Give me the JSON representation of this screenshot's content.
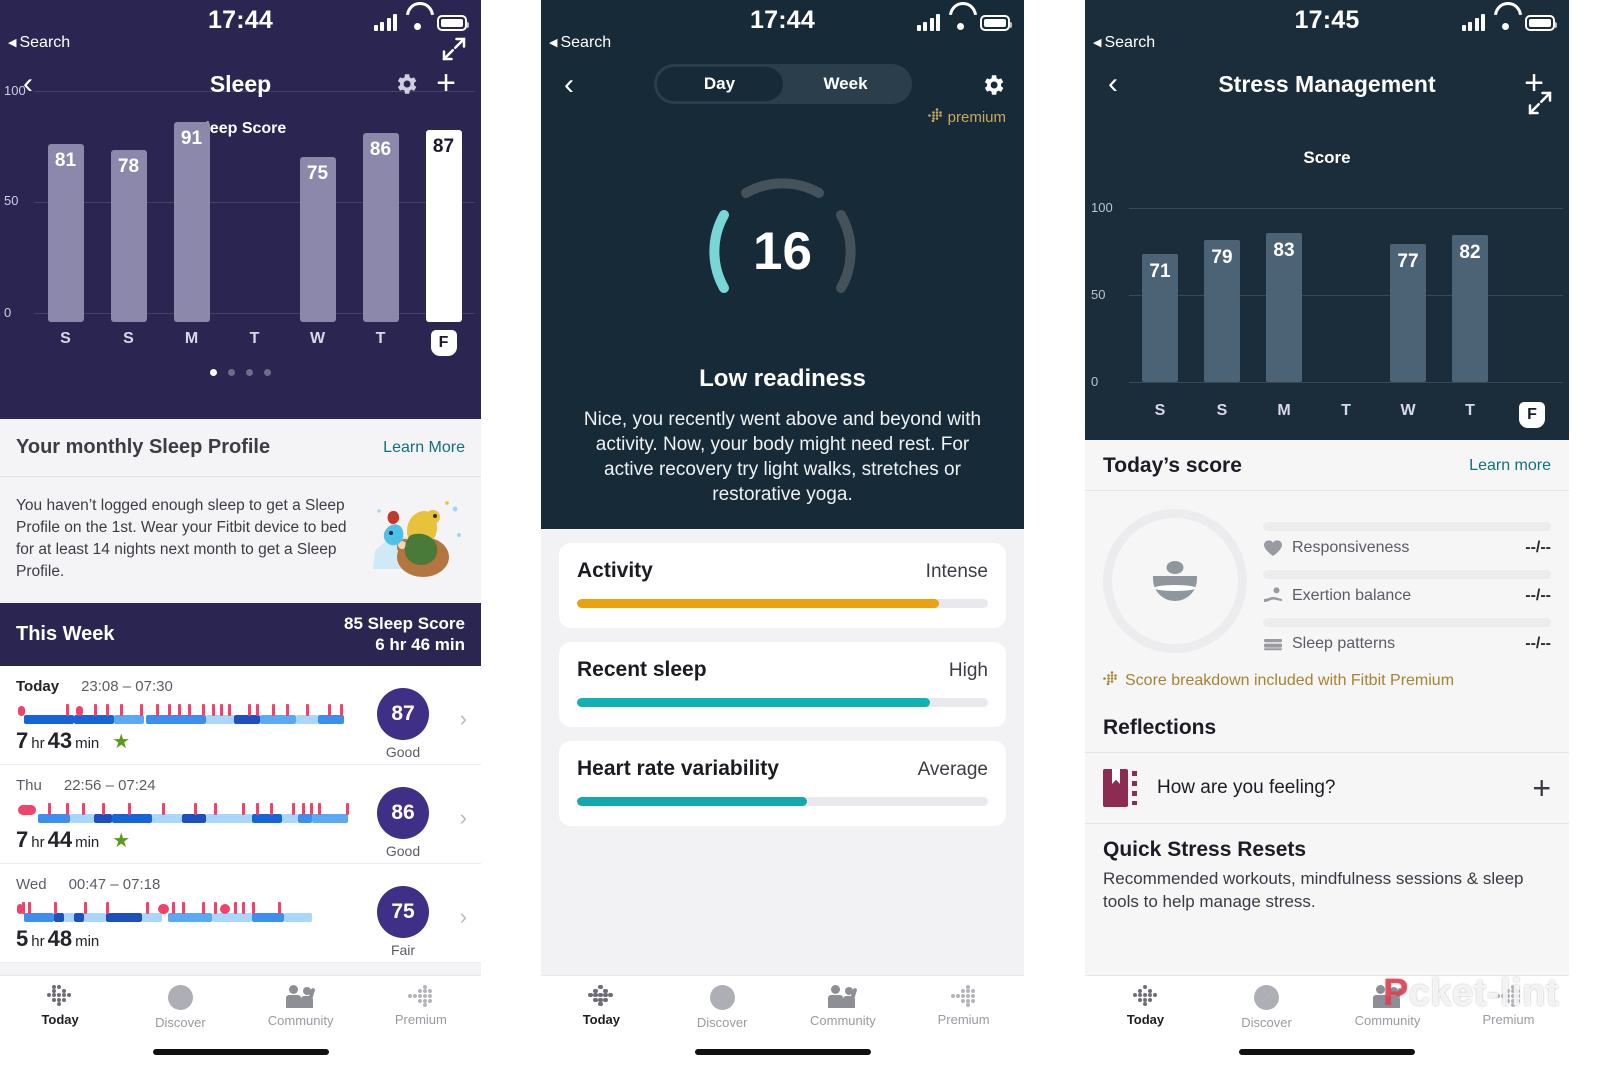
{
  "panels": {
    "sleep": {
      "status": {
        "time": "17:44",
        "back_label": "Search"
      },
      "nav": {
        "title": "Sleep",
        "gear": "gear-icon",
        "plus": "plus-icon",
        "back": "chevron-left-icon"
      },
      "chart_title": "Sleep Score",
      "profile": {
        "heading": "Your monthly Sleep Profile",
        "learn_more": "Learn More",
        "body": "You haven’t logged enough sleep to get a Sleep Profile on the 1st. Wear your Fitbit device to bed for at least 14 nights next month to get a Sleep Profile."
      },
      "week_header": {
        "left": "This Week",
        "right_line1": "85 Sleep Score",
        "right_line2": "6 hr 46 min"
      },
      "rows": [
        {
          "day": "Today",
          "time": "23:08 – 07:30",
          "hours": "7",
          "hr_unit": "hr",
          "mins": "43",
          "min_unit": "min",
          "star": true,
          "score": "87",
          "quality": "Good"
        },
        {
          "day": "Thu",
          "time": "22:56 – 07:24",
          "hours": "7",
          "hr_unit": "hr",
          "mins": "44",
          "min_unit": "min",
          "star": true,
          "score": "86",
          "quality": "Good"
        },
        {
          "day": "Wed",
          "time": "00:47 – 07:18",
          "hours": "5",
          "hr_unit": "hr",
          "mins": "48",
          "min_unit": "min",
          "star": false,
          "score": "75",
          "quality": "Fair"
        }
      ],
      "tabs": [
        {
          "label": "Today",
          "icon": "fitbit-dots-icon",
          "active": true
        },
        {
          "label": "Discover",
          "icon": "compass-icon",
          "active": false
        },
        {
          "label": "Community",
          "icon": "people-icon",
          "active": false
        },
        {
          "label": "Premium",
          "icon": "premium-dots-icon",
          "active": false
        }
      ]
    },
    "readiness": {
      "status": {
        "time": "17:44",
        "back_label": "Search"
      },
      "segmented": {
        "options": [
          "Day",
          "Week"
        ],
        "selected": "Week"
      },
      "nav": {
        "gear": "gear-icon",
        "back": "chevron-left-icon"
      },
      "premium_tag": "premium",
      "score": "16",
      "headline": "Low readiness",
      "description": "Nice, you recently went above and beyond with activity. Now, your body might need rest. For active recovery try light walks, stretches or restorative yoga.",
      "cards": [
        {
          "name": "Activity",
          "value": "Intense",
          "percent": 88,
          "color": "#eaa210"
        },
        {
          "name": "Recent sleep",
          "value": "High",
          "percent": 86,
          "color": "#11b0b5"
        },
        {
          "name": "Heart rate variability",
          "value": "Average",
          "percent": 56,
          "color": "#11a8b0"
        }
      ],
      "tabs": [
        {
          "label": "Today",
          "icon": "fitbit-dots-icon",
          "active": true
        },
        {
          "label": "Discover",
          "icon": "compass-icon",
          "active": false
        },
        {
          "label": "Community",
          "icon": "people-icon",
          "active": false
        },
        {
          "label": "Premium",
          "icon": "premium-dots-icon",
          "active": false
        }
      ]
    },
    "stress": {
      "status": {
        "time": "17:45",
        "back_label": "Search"
      },
      "nav": {
        "title": "Stress Management",
        "plus": "plus-icon",
        "back": "chevron-left-icon"
      },
      "chart_title": "Score",
      "today_score": {
        "heading": "Today’s score",
        "learn_more": "Learn more"
      },
      "metrics": [
        {
          "label": "Responsiveness",
          "value": "--/--",
          "icon": "heart-icon"
        },
        {
          "label": "Exertion balance",
          "value": "--/--",
          "icon": "exertion-icon"
        },
        {
          "label": "Sleep patterns",
          "value": "--/--",
          "icon": "bed-icon"
        }
      ],
      "premium_note": "Score breakdown included with Fitbit Premium",
      "reflections": {
        "title": "Reflections",
        "question": "How are you feeling?",
        "add": "plus-icon",
        "icon": "journal-icon"
      },
      "quick_resets": {
        "title": "Quick Stress Resets",
        "body": "Recommended workouts, mindfulness sessions & sleep tools to help manage stress."
      },
      "tabs": [
        {
          "label": "Today",
          "icon": "fitbit-dots-icon",
          "active": true
        },
        {
          "label": "Discover",
          "icon": "compass-icon",
          "active": false
        },
        {
          "label": "Community",
          "icon": "people-icon",
          "active": false
        },
        {
          "label": "Premium",
          "icon": "premium-dots-icon",
          "active": false
        }
      ]
    }
  },
  "watermark": {
    "text_a": "P",
    "text_b": "cket-lint"
  },
  "chart_data": [
    {
      "type": "bar",
      "title": "Sleep Score",
      "categories": [
        "S",
        "S",
        "M",
        "T",
        "W",
        "T",
        "F"
      ],
      "values": [
        81,
        78,
        91,
        null,
        75,
        86,
        87
      ],
      "ylim": [
        0,
        100
      ],
      "yticks": [
        0,
        50,
        100
      ],
      "ylabel": "",
      "xlabel": "",
      "highlight_index": 6,
      "bar_color": "#8b88ab",
      "highlight_color": "#ffffff",
      "background": "#2b2552",
      "grid": true,
      "page_dots": {
        "count": 4,
        "active": 0
      }
    },
    {
      "type": "bar",
      "title": "Score",
      "categories": [
        "S",
        "S",
        "M",
        "T",
        "W",
        "T",
        "F"
      ],
      "values": [
        71,
        79,
        83,
        null,
        77,
        82,
        null
      ],
      "ylim": [
        0,
        100
      ],
      "yticks": [
        0,
        50,
        100
      ],
      "ylabel": "",
      "xlabel": "",
      "highlight_index": 6,
      "bar_color": "#4c6375",
      "background": "#1b2d3b",
      "grid": true
    }
  ]
}
